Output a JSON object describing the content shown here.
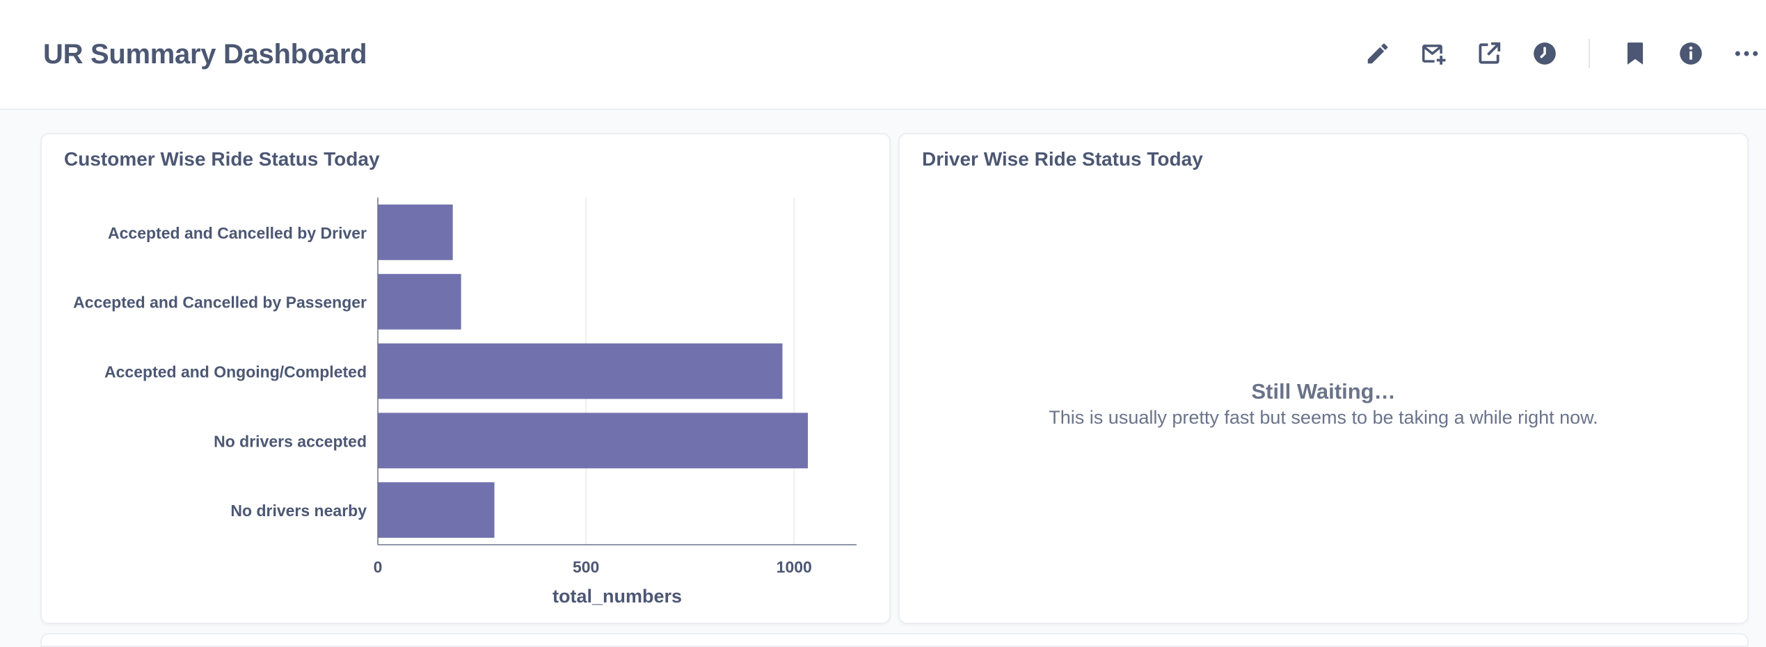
{
  "header": {
    "title": "UR Summary Dashboard",
    "toolbar": [
      {
        "name": "edit-button",
        "icon": "pencil-icon"
      },
      {
        "name": "subscribe-button",
        "icon": "mail-add-icon"
      },
      {
        "name": "share-button",
        "icon": "external-link-icon"
      },
      {
        "name": "auto-refresh-button",
        "icon": "clock-icon"
      },
      {
        "name": "bookmark-button",
        "icon": "bookmark-icon"
      },
      {
        "name": "info-button",
        "icon": "info-icon"
      },
      {
        "name": "more-button",
        "icon": "ellipsis-icon"
      }
    ]
  },
  "cards": {
    "left": {
      "title": "Customer Wise Ride Status Today"
    },
    "right": {
      "title": "Driver Wise Ride Status Today",
      "waiting_title": "Still Waiting…",
      "waiting_text": "This is usually pretty fast but seems to be taking a while right now."
    }
  },
  "chart_data": {
    "type": "bar",
    "orientation": "horizontal",
    "categories": [
      "Accepted and Cancelled by Driver",
      "Accepted and Cancelled by Passenger",
      "Accepted and Ongoing/Completed",
      "No drivers accepted",
      "No drivers nearby"
    ],
    "values": [
      180,
      200,
      972,
      1033,
      280
    ],
    "xlabel": "total_numbers",
    "ylabel": "",
    "xlim": [
      0,
      1150
    ],
    "xticks": [
      0,
      500,
      1000
    ],
    "grid": true,
    "bar_color": "#7172ad"
  }
}
